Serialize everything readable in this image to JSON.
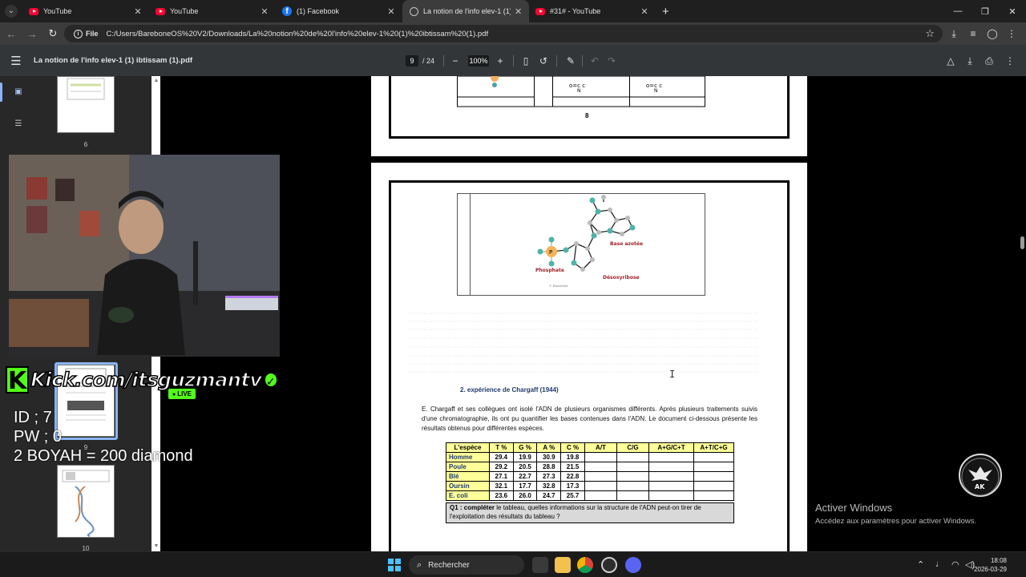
{
  "browser": {
    "tabs": [
      {
        "label": "YouTube",
        "icon": "youtube-icon",
        "active": false
      },
      {
        "label": "YouTube",
        "icon": "youtube-icon",
        "active": false
      },
      {
        "label": "(1) Facebook",
        "icon": "facebook-icon",
        "active": false
      },
      {
        "label": "La notion de l'info elev-1 (1) ib",
        "icon": "globe-icon",
        "active": true
      },
      {
        "label": "#31# - YouTube",
        "icon": "youtube-icon",
        "active": false
      }
    ],
    "new_tab": "+",
    "address": {
      "chip_label": "File",
      "url": "C:/Users/BareboneOS%20V2/Downloads/La%20notion%20de%20l'info%20elev-1%20(1)%20ibtissam%20(1).pdf"
    }
  },
  "pdf_toolbar": {
    "title": "La notion de l'info elev-1 (1) ibtissam (1).pdf",
    "current_page": "9",
    "total_pages": "/ 24",
    "zoom": "100%"
  },
  "sidebar": {
    "thumbnails": [
      {
        "page": "6"
      },
      {
        "page": "9"
      },
      {
        "page": "10"
      }
    ]
  },
  "document": {
    "prev_page_number": "8",
    "figure_labels": {
      "base": "Base azotée",
      "phosphate": "Phosphate",
      "sugar": "Désoxyribose",
      "phosphate_symbol": "P",
      "credit": "© Biostatistic"
    },
    "section_title": "2.     expérience de Chargaff (1944)",
    "paragraph": "E. Chargaff et ses collègues ont isolé l'ADN de plusieurs organismes différents. Après plusieurs traitements suivis d'une chromatographie, ils ont pu quantifier les bases contenues dans l'ADN. Le document ci-dessous présente les résultats obtenus pour différentes espèces.",
    "table": {
      "headers": [
        "L'espèce",
        "T %",
        "G %",
        "A %",
        "C %",
        "A/T",
        "C/G",
        "A+G/C+T",
        "A+T/C+G"
      ],
      "rows": [
        {
          "species": "Homme",
          "values": [
            "29.4",
            "19.9",
            "30.9",
            "19.8"
          ]
        },
        {
          "species": "Poule",
          "values": [
            "29.2",
            "20.5",
            "28.8",
            "21.5"
          ]
        },
        {
          "species": "Blé",
          "values": [
            "27.1",
            "22.7",
            "27.3",
            "22.8"
          ]
        },
        {
          "species": "Oursin",
          "values": [
            "32.1",
            "17.7",
            "32.8",
            "17.3"
          ]
        },
        {
          "species": "E. coli",
          "values": [
            "23.6",
            "26.0",
            "24.7",
            "25.7"
          ]
        }
      ]
    },
    "question_prefix": "Q1 : compléter",
    "question_rest": " le tableau, quelles informations sur la structure de l'ADN peut-on tirer de l'exploitation des résultats du tableau ?"
  },
  "stream_overlay": {
    "kick_brand": "Kick.com/itsguzmantv",
    "live_label": "LIVE",
    "id_line": "ID ; 7",
    "pw_line": "PW ; 0",
    "promo_line": "2 BOYAH = 200 diamond"
  },
  "windows": {
    "activate_title": "Activer Windows",
    "activate_subtitle": "Accédez aux paramètres pour activer Windows.",
    "search_placeholder": "Rechercher",
    "clock_time": "18:08",
    "clock_date": "2026-03-29"
  },
  "colors": {
    "kick_green": "#53fc18",
    "chrome_dark": "#1f1f1f",
    "pdf_toolbar": "#323639",
    "table_header_yellow": "#ffff99",
    "section_title_blue": "#1f3a6b"
  }
}
